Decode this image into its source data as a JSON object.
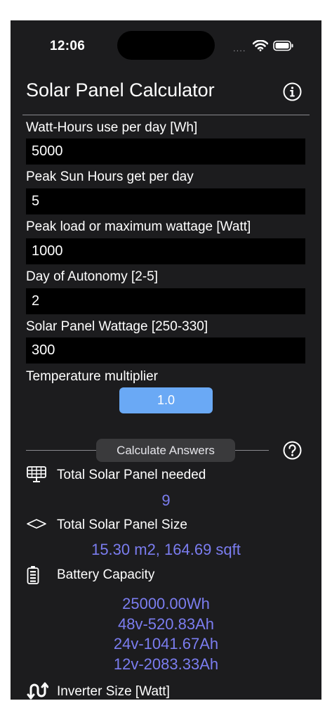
{
  "status_bar": {
    "time": "12:06",
    "dots": "....",
    "wifi_icon": "wifi-icon",
    "battery_icon": "battery-icon"
  },
  "header": {
    "title": "Solar Panel Calculator",
    "info_icon": "info-circle-icon"
  },
  "inputs": [
    {
      "label": "Watt-Hours use per day [Wh]",
      "value": "5000"
    },
    {
      "label": "Peak Sun Hours get per day",
      "value": "5"
    },
    {
      "label": "Peak load or maximum wattage [Watt]",
      "value": "1000"
    },
    {
      "label": "Day of Autonomy [2-5]",
      "value": "2"
    },
    {
      "label": "Solar Panel Wattage [250-330]",
      "value": "300"
    }
  ],
  "temperature": {
    "label": "Temperature multiplier",
    "value": "1.0"
  },
  "calculate": {
    "label": "Calculate Answers",
    "help_icon": "question-circle-icon"
  },
  "results": {
    "panels": {
      "label": "Total Solar Panel needed",
      "value": "9",
      "icon": "solar-panel-icon"
    },
    "size": {
      "label": "Total Solar Panel Size",
      "value": "15.30 m2, 164.69 sqft",
      "icon": "rhombus-icon"
    },
    "battery": {
      "label": "Battery Capacity",
      "icon": "battery-vertical-icon",
      "values": [
        "25000.00Wh",
        "48v-520.83Ah",
        "24v-1041.67Ah",
        "12v-2083.33Ah"
      ]
    },
    "inverter": {
      "label": "Inverter Size [Watt]",
      "icon": "inverter-arrows-icon"
    }
  },
  "colors": {
    "background": "#1c1c1e",
    "accent": "#6aa9f5",
    "result_text": "#7b7df0"
  }
}
